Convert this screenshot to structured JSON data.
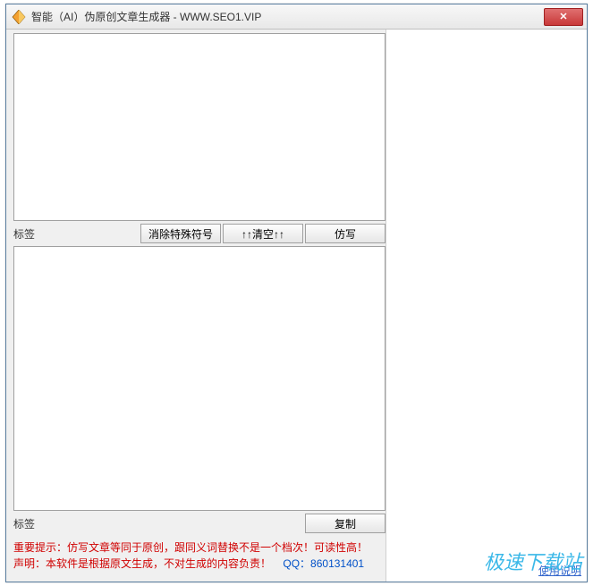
{
  "window": {
    "title": "智能（AI）伪原创文章生成器 - WWW.SEO1.VIP",
    "close_glyph": "✕"
  },
  "top": {
    "label": "标签",
    "btn_clear_special": "消除特殊符号",
    "btn_clear": "↑↑清空↑↑",
    "btn_rewrite": "仿写",
    "textarea_value": ""
  },
  "bottom": {
    "label": "标签",
    "btn_copy": "复制",
    "textarea_value": ""
  },
  "notice": {
    "line1_a": "重要提示：仿写文章等同于原创，跟同义词替换不是一个档次！可读性高！",
    "line2_a": "声明：本软件是根据原文生成，不对生成的内容负责！",
    "line2_b": "QQ：860131401"
  },
  "right": {
    "usage_link": "使用说明"
  },
  "watermark": "极速下载站"
}
